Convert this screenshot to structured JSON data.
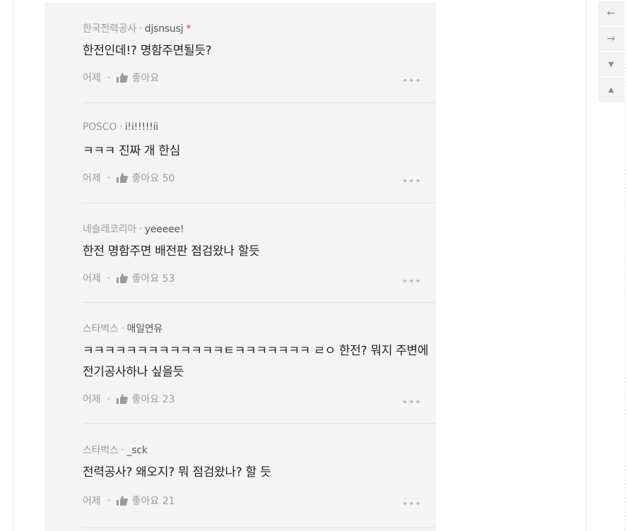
{
  "comments": [
    {
      "source": "한국전력공사",
      "user": "djsnsusj",
      "star": "*",
      "lines": [
        "한전인데!? 명함주면될듯?"
      ],
      "time": "어제",
      "like_label": "좋아요",
      "like_count": ""
    },
    {
      "source": "POSCO",
      "user": "i!i!!!!!ii",
      "star": "",
      "lines": [
        "ㅋㅋㅋ 진짜 개 한심"
      ],
      "time": "어제",
      "like_label": "좋아요",
      "like_count": "50"
    },
    {
      "source": "네슬레코리아",
      "user": "yeeeee!",
      "star": "",
      "lines": [
        "한전 명함주면 배전판 점검왔나 할듯"
      ],
      "time": "어제",
      "like_label": "좋아요",
      "like_count": "53"
    },
    {
      "source": "스타벅스",
      "user": "매일연유",
      "star": "",
      "lines": [
        "ㅋㅋㅋㅋㅋㅋㅋㅋㅋㅋㅋㅋㅋㅌㅋㅋㅋㅋㅋㅋㅋ ㄹㅇ 한전? 뭐지 주변에",
        "전기공사하나 싶을듯"
      ],
      "time": "어제",
      "like_label": "좋아요",
      "like_count": "23"
    },
    {
      "source": "스타벅스",
      "user": "_sck",
      "star": "",
      "lines": [
        "전력공사? 왜오지? 뭐 점검왔나? 할 듯"
      ],
      "time": "어제",
      "like_label": "좋아요",
      "like_count": "21"
    }
  ],
  "nav": {
    "buttons": [
      "←",
      "→",
      "▼",
      "▲"
    ]
  },
  "more_label": "•••",
  "dot": "•"
}
